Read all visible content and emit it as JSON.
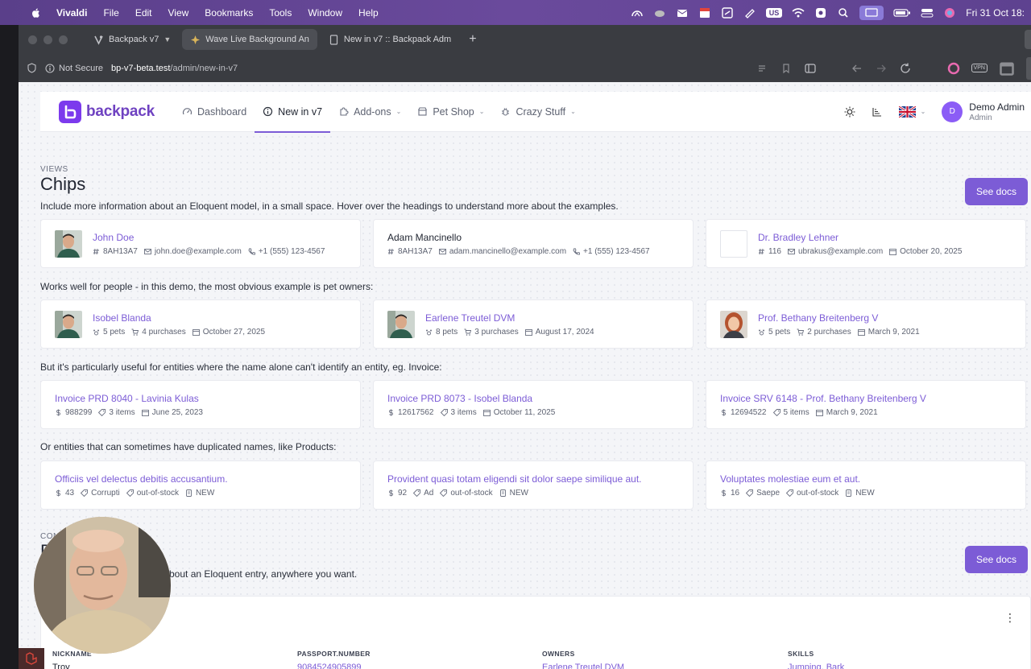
{
  "menubar": {
    "app_name": "Vivaldi",
    "items": [
      "File",
      "Edit",
      "View",
      "Bookmarks",
      "Tools",
      "Window",
      "Help"
    ],
    "keyboard": "US",
    "clock": "Fri 31 Oct  18:"
  },
  "browser": {
    "tabs": [
      {
        "label": "Backpack v7",
        "icon": "vivaldi-icon"
      },
      {
        "label": "Wave Live Background An",
        "icon": "wave-icon"
      },
      {
        "label": "New in v7 :: Backpack Adm",
        "icon": "page-icon"
      }
    ],
    "security_label": "Not Secure",
    "url_host": "bp-v7-beta.test",
    "url_path": "/admin/new-in-v7",
    "vpn_label": "VPN"
  },
  "nav": {
    "brand": "backpack",
    "items": [
      {
        "label": "Dashboard",
        "icon": "gauge-icon"
      },
      {
        "label": "New in v7",
        "icon": "info-circle-icon"
      },
      {
        "label": "Add-ons",
        "icon": "puzzle-icon"
      },
      {
        "label": "Pet Shop",
        "icon": "shop-icon"
      },
      {
        "label": "Crazy Stuff",
        "icon": "bug-icon"
      }
    ],
    "user_initial": "D",
    "user_name": "Demo Admin",
    "user_role": "Admin"
  },
  "chips_section": {
    "eyebrow": "VIEWS",
    "title": "Chips",
    "description": "Include more information about an Eloquent model, in a small space. Hover over the headings to understand more about the examples.",
    "docs_label": "See docs",
    "rows": [
      {
        "label": "",
        "cards": [
          {
            "title": "John Doe",
            "link": true,
            "picture": "person",
            "meta": [
              {
                "icon": "hash-icon",
                "text": "8AH13A7"
              },
              {
                "icon": "mail-icon",
                "text": "john.doe@example.com"
              },
              {
                "icon": "phone-icon",
                "text": "+1 (555) 123-4567"
              }
            ]
          },
          {
            "title": "Adam Mancinello",
            "link": false,
            "picture": "none",
            "meta": [
              {
                "icon": "hash-icon",
                "text": "8AH13A7"
              },
              {
                "icon": "mail-icon",
                "text": "adam.mancinello@example.com"
              },
              {
                "icon": "phone-icon",
                "text": "+1 (555) 123-4567"
              }
            ]
          },
          {
            "title": "Dr. Bradley Lehner",
            "link": true,
            "picture": "empty",
            "meta": [
              {
                "icon": "hash-icon",
                "text": "116"
              },
              {
                "icon": "mail-icon",
                "text": "ubrakus@example.com"
              },
              {
                "icon": "calendar-icon",
                "text": "October 20, 2025"
              }
            ]
          }
        ]
      },
      {
        "label": "Works well for people - in this demo, the most obvious example is pet owners:",
        "cards": [
          {
            "title": "Isobel Blanda",
            "link": true,
            "picture": "person",
            "meta": [
              {
                "icon": "paw-icon",
                "text": "5 pets"
              },
              {
                "icon": "cart-icon",
                "text": "4 purchases"
              },
              {
                "icon": "calendar-icon",
                "text": "October 27, 2025"
              }
            ]
          },
          {
            "title": "Earlene Treutel DVM",
            "link": true,
            "picture": "person",
            "meta": [
              {
                "icon": "paw-icon",
                "text": "8 pets"
              },
              {
                "icon": "cart-icon",
                "text": "3 purchases"
              },
              {
                "icon": "calendar-icon",
                "text": "August 17, 2024"
              }
            ]
          },
          {
            "title": "Prof. Bethany Breitenberg V",
            "link": true,
            "picture": "woman",
            "meta": [
              {
                "icon": "paw-icon",
                "text": "5 pets"
              },
              {
                "icon": "cart-icon",
                "text": "2 purchases"
              },
              {
                "icon": "calendar-icon",
                "text": "March 9, 2021"
              }
            ]
          }
        ]
      },
      {
        "label": "But it's particularly useful for entities where the name alone can't identify an entity, eg. Invoice:",
        "cards": [
          {
            "title": "Invoice PRD 8040 - Lavinia Kulas",
            "link": true,
            "picture": "none",
            "meta": [
              {
                "icon": "dollar-icon",
                "text": "988299"
              },
              {
                "icon": "tag-icon",
                "text": "3 items"
              },
              {
                "icon": "calendar-icon",
                "text": "June 25, 2023"
              }
            ]
          },
          {
            "title": "Invoice PRD 8073 - Isobel Blanda",
            "link": true,
            "picture": "none",
            "meta": [
              {
                "icon": "dollar-icon",
                "text": "12617562"
              },
              {
                "icon": "tag-icon",
                "text": "3 items"
              },
              {
                "icon": "calendar-icon",
                "text": "October 11, 2025"
              }
            ]
          },
          {
            "title": "Invoice SRV 6148 - Prof. Bethany Breitenberg V",
            "link": true,
            "picture": "none",
            "meta": [
              {
                "icon": "dollar-icon",
                "text": "12694522"
              },
              {
                "icon": "tag-icon",
                "text": "5 items"
              },
              {
                "icon": "calendar-icon",
                "text": "March 9, 2021"
              }
            ]
          }
        ]
      },
      {
        "label": "Or entities that can sometimes have duplicated names, like Products:",
        "cards": [
          {
            "title": "Officiis vel delectus debitis accusantium.",
            "link": true,
            "picture": "none",
            "meta": [
              {
                "icon": "dollar-icon",
                "text": "43"
              },
              {
                "icon": "tag-icon",
                "text": "Corrupti"
              },
              {
                "icon": "tag-icon",
                "text": "out-of-stock"
              },
              {
                "icon": "badge-icon",
                "text": "NEW"
              }
            ]
          },
          {
            "title": "Provident quasi totam eligendi sit dolor saepe similique aut.",
            "link": true,
            "picture": "none",
            "meta": [
              {
                "icon": "dollar-icon",
                "text": "92"
              },
              {
                "icon": "tag-icon",
                "text": "Ad"
              },
              {
                "icon": "tag-icon",
                "text": "out-of-stock"
              },
              {
                "icon": "badge-icon",
                "text": "NEW"
              }
            ]
          },
          {
            "title": "Voluptates molestiae eum et aut.",
            "link": true,
            "picture": "none",
            "meta": [
              {
                "icon": "dollar-icon",
                "text": "16"
              },
              {
                "icon": "tag-icon",
                "text": "Saepe"
              },
              {
                "icon": "tag-icon",
                "text": "out-of-stock"
              },
              {
                "icon": "badge-icon",
                "text": "NEW"
              }
            ]
          }
        ]
      }
    ]
  },
  "details_section": {
    "eyebrow": "CON",
    "title": "D",
    "description": "bout an Eloquent entry, anywhere you want.",
    "docs_label": "See docs",
    "columns": [
      {
        "header": "NICKNAME",
        "value": "Troy",
        "link": false
      },
      {
        "header": "PASSPORT.NUMBER",
        "value": "9084524905899",
        "link": true
      },
      {
        "header": "OWNERS",
        "value": "Earlene Treutel DVM",
        "link": true
      },
      {
        "header": "SKILLS",
        "value": "Jumping, Bark",
        "link": true
      }
    ]
  },
  "colors": {
    "accent": "#7c5cd6",
    "brand": "#6f42c1",
    "menubar": "#5a3f8a"
  }
}
